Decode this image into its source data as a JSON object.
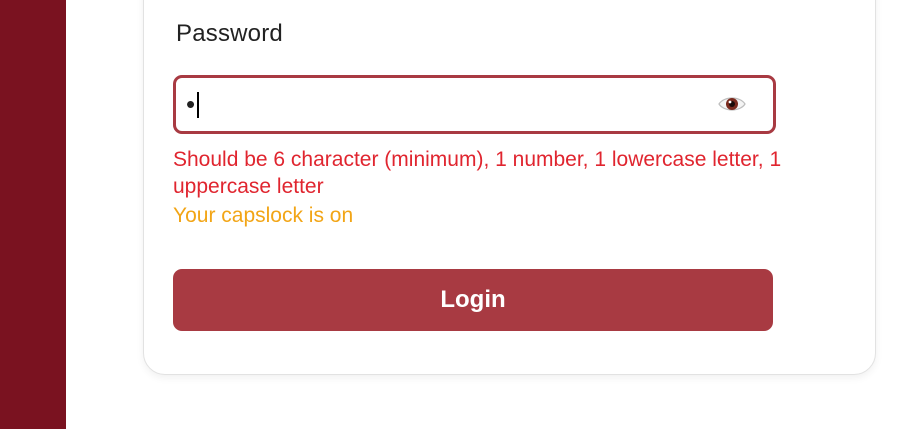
{
  "form": {
    "password_label": "Password",
    "password_value": "•",
    "validation_error": "Should be 6 character (minimum), 1 number, 1 lowercase letter, 1 uppercase letter",
    "capslock_warning": "Your capslock is on",
    "login_label": "Login"
  },
  "icons": {
    "show_password": "eye-icon"
  },
  "colors": {
    "sidebar": "#7a1220",
    "accent": "#a83a42",
    "error": "#e0252f",
    "warning": "#f2a516"
  }
}
